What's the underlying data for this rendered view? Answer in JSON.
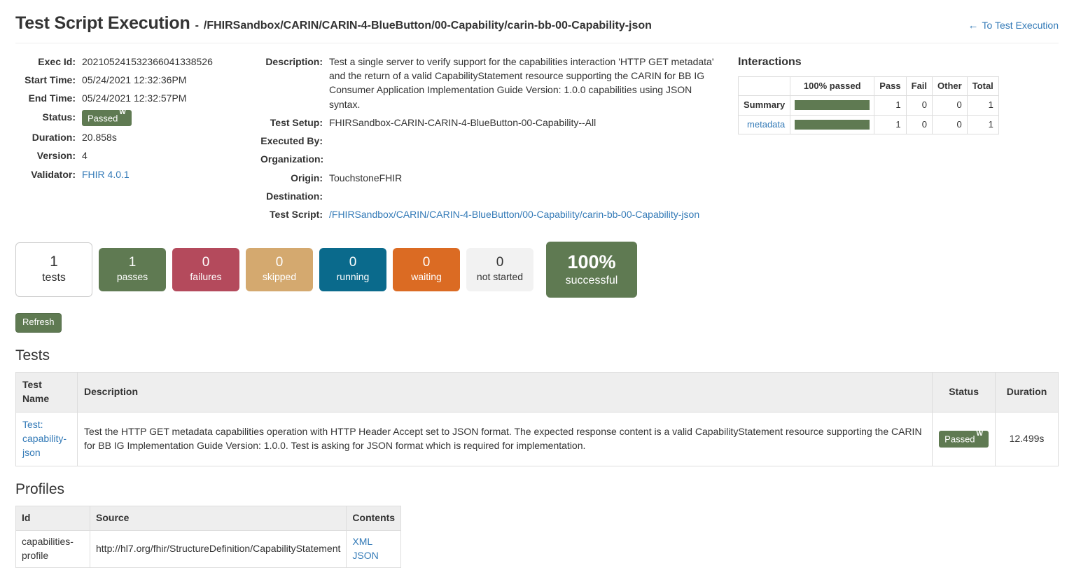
{
  "header": {
    "title": "Test Script Execution",
    "separator": "-",
    "script_path": "/FHIRSandbox/CARIN/CARIN-4-BlueButton/00-Capability/carin-bb-00-Capability-json",
    "back_link": "To Test Execution",
    "back_icon": "arrow-left-icon"
  },
  "exec_info": {
    "labels": {
      "exec_id": "Exec Id:",
      "start_time": "Start Time:",
      "end_time": "End Time:",
      "status": "Status:",
      "duration": "Duration:",
      "version": "Version:",
      "validator": "Validator:"
    },
    "values": {
      "exec_id": "202105241532366041338526",
      "start_time": "05/24/2021 12:32:36PM",
      "end_time": "05/24/2021 12:32:57PM",
      "status": "Passed",
      "status_sup": "W",
      "duration": "20.858s",
      "version": "4",
      "validator": "FHIR 4.0.1"
    }
  },
  "script_info": {
    "labels": {
      "description": "Description:",
      "test_setup": "Test Setup:",
      "executed_by": "Executed By:",
      "organization": "Organization:",
      "origin": "Origin:",
      "destination": "Destination:",
      "test_script": "Test Script:"
    },
    "values": {
      "description": "Test a single server to verify support for the capabilities interaction 'HTTP GET metadata' and the return of a valid CapabilityStatement resource supporting the CARIN for BB IG Consumer Application Implementation Guide Version: 1.0.0 capabilities using JSON syntax.",
      "test_setup": "FHIRSandbox-CARIN-CARIN-4-BlueButton-00-Capability--All",
      "executed_by": "",
      "organization": "",
      "origin": "TouchstoneFHIR",
      "destination": "",
      "test_script": "/FHIRSandbox/CARIN/CARIN-4-BlueButton/00-Capability/carin-bb-00-Capability-json"
    }
  },
  "interactions": {
    "heading": "Interactions",
    "columns": [
      "",
      "100% passed",
      "Pass",
      "Fail",
      "Other",
      "Total"
    ],
    "rows": [
      {
        "name": "Summary",
        "is_link": false,
        "percent": 100,
        "pass": "1",
        "fail": "0",
        "other": "0",
        "total": "1"
      },
      {
        "name": "metadata",
        "is_link": true,
        "percent": 100,
        "pass": "1",
        "fail": "0",
        "other": "0",
        "total": "1"
      }
    ]
  },
  "stats": [
    {
      "num": "1",
      "label": "tests",
      "style": "plain",
      "color": "#ffffff"
    },
    {
      "num": "1",
      "label": "passes",
      "style": "passes",
      "color": "#5f7a52"
    },
    {
      "num": "0",
      "label": "failures",
      "style": "failures",
      "color": "#b44a5c"
    },
    {
      "num": "0",
      "label": "skipped",
      "style": "skipped",
      "color": "#d4a96f"
    },
    {
      "num": "0",
      "label": "running",
      "style": "running",
      "color": "#0a6а8c"
    },
    {
      "num": "0",
      "label": "waiting",
      "style": "waiting",
      "color": "#db6b23"
    },
    {
      "num": "0",
      "label": "not started",
      "style": "notstarted",
      "color": "#f2f2f2"
    },
    {
      "num": "100%",
      "label": "successful",
      "style": "big",
      "color": "#5f7a52"
    }
  ],
  "refresh": {
    "label": "Refresh"
  },
  "tests": {
    "heading": "Tests",
    "columns": [
      "Test Name",
      "Description",
      "Status",
      "Duration"
    ],
    "rows": [
      {
        "name": "Test: capability-json",
        "description": "Test the HTTP GET metadata capabilities operation with HTTP Header Accept set to JSON format. The expected response content is a valid CapabilityStatement resource supporting the CARIN for BB IG Implementation Guide Version: 1.0.0. Test is asking for JSON format which is required for implementation.",
        "status": "Passed",
        "status_sup": "W",
        "duration": "12.499s"
      }
    ]
  },
  "profiles": {
    "heading": "Profiles",
    "columns": [
      "Id",
      "Source",
      "Contents"
    ],
    "rows": [
      {
        "id": "capabilities-profile",
        "source": "http://hl7.org/fhir/StructureDefinition/CapabilityStatement",
        "contents": [
          "XML",
          "JSON"
        ]
      }
    ]
  },
  "colors": {
    "link": "#337ab7",
    "green": "#5f7a52",
    "red": "#b44a5c",
    "tan": "#d4a96f",
    "blue": "#0a6a8c",
    "orange": "#db6b23",
    "gray": "#f2f2f2",
    "border": "#dddddd",
    "header_bg": "#eeeeee"
  }
}
